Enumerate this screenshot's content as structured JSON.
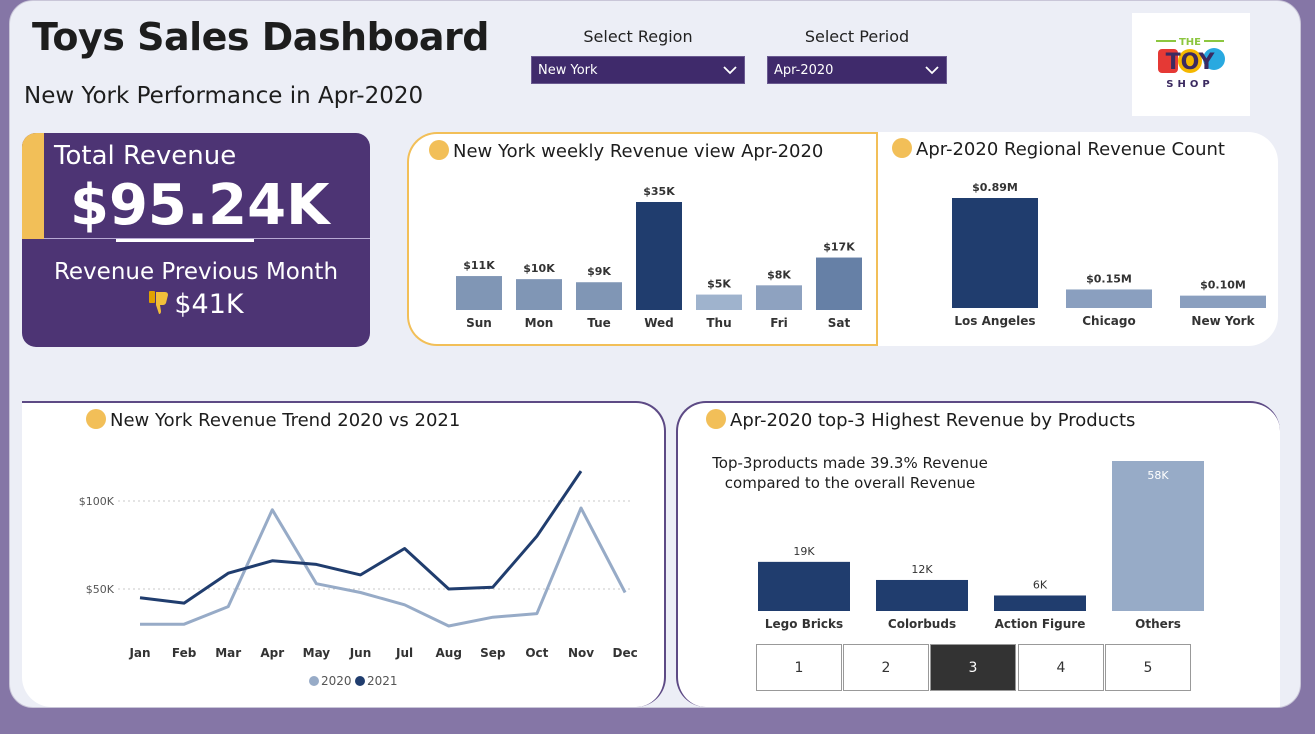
{
  "header": {
    "title": "Toys Sales Dashboard",
    "subtitle": "New York Performance in Apr-2020"
  },
  "filters": {
    "region_label": "Select Region",
    "region_value": "New York",
    "period_label": "Select Period",
    "period_value": "Apr-2020"
  },
  "logo": {
    "line1": "THE",
    "line2": "TOY",
    "line3": "SHOP"
  },
  "kpi": {
    "title": "Total Revenue",
    "value": "$95.24K",
    "prev_label": "Revenue Previous Month",
    "prev_value": "$41K",
    "prev_icon": "thumbs-down-icon"
  },
  "colors": {
    "accent": "#f2bf58",
    "kpi_bg": "#4d3474",
    "navy": "#203d6e",
    "steel": "#8096b5",
    "light": "#97abc7"
  },
  "insight_text": "Top-3products made 39.3% Revenue compared to the overall Revenue",
  "pager": {
    "pages": [
      "1",
      "2",
      "3",
      "4",
      "5"
    ],
    "active_index": 2
  },
  "chart_data": [
    {
      "type": "bar",
      "title": "New York weekly Revenue view Apr-2020",
      "categories": [
        "Sun",
        "Mon",
        "Tue",
        "Wed",
        "Thu",
        "Fri",
        "Sat"
      ],
      "values": [
        11,
        10,
        9,
        35,
        5,
        8,
        17
      ],
      "labels": [
        "$11K",
        "$10K",
        "$9K",
        "$35K",
        "$5K",
        "$8K",
        "$17K"
      ],
      "colors": [
        "#8096b5",
        "#8096b5",
        "#8096b5",
        "#203d6e",
        "#9fb3cd",
        "#8ea2c0",
        "#6680a6"
      ]
    },
    {
      "type": "bar",
      "title": "Apr-2020 Regional Revenue Count",
      "categories": [
        "Los Angeles",
        "Chicago",
        "New York"
      ],
      "values": [
        0.89,
        0.15,
        0.1
      ],
      "labels": [
        "$0.89M",
        "$0.15M",
        "$0.10M"
      ],
      "colors": [
        "#203d6e",
        "#8a9fbf",
        "#8a9fbf"
      ]
    },
    {
      "type": "line",
      "title": "New York Revenue Trend 2020 vs 2021",
      "categories": [
        "Jan",
        "Feb",
        "Mar",
        "Apr",
        "May",
        "Jun",
        "Jul",
        "Aug",
        "Sep",
        "Oct",
        "Nov",
        "Dec"
      ],
      "ylim": [
        30000,
        120000
      ],
      "yticks": [
        {
          "value": 100000,
          "label": "$100K"
        },
        {
          "value": 50000,
          "label": "$50K"
        }
      ],
      "series": [
        {
          "name": "2020",
          "color": "#97abc7",
          "values": [
            30000,
            30000,
            40000,
            95000,
            53000,
            48000,
            41000,
            29000,
            34000,
            36000,
            96000,
            48000
          ]
        },
        {
          "name": "2021",
          "color": "#203d6e",
          "values": [
            45000,
            42000,
            59000,
            66000,
            64000,
            58000,
            73000,
            50000,
            51000,
            80000,
            117000,
            null
          ]
        }
      ]
    },
    {
      "type": "bar",
      "title": "Apr-2020 top-3 Highest Revenue by Products",
      "categories": [
        "Lego Bricks",
        "Colorbuds",
        "Action Figure",
        "Others"
      ],
      "values": [
        19,
        12,
        6,
        58
      ],
      "labels": [
        "19K",
        "12K",
        "6K",
        "58K"
      ],
      "colors": [
        "#203d6e",
        "#203d6e",
        "#203d6e",
        "#97abc7"
      ]
    }
  ]
}
